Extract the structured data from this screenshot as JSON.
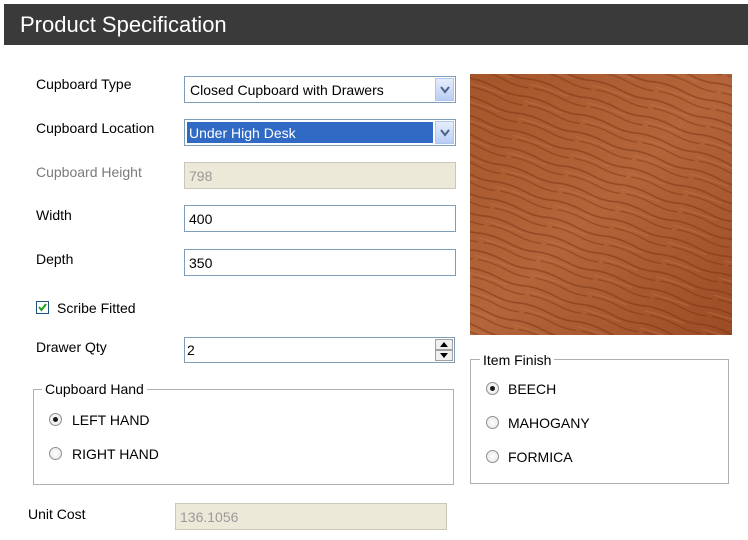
{
  "header": {
    "title": "Product Specification"
  },
  "form": {
    "cupboard_type": {
      "label": "Cupboard Type",
      "value": "Closed Cupboard with Drawers"
    },
    "cupboard_location": {
      "label": "Cupboard Location",
      "value": "Under High Desk"
    },
    "cupboard_height": {
      "label": "Cupboard Height",
      "value": "798"
    },
    "width": {
      "label": "Width",
      "value": "400"
    },
    "depth": {
      "label": "Depth",
      "value": "350"
    },
    "scribe_fitted": {
      "label": "Scribe Fitted",
      "checked": true
    },
    "drawer_qty": {
      "label": "Drawer Qty",
      "value": "2"
    },
    "cupboard_hand": {
      "legend": "Cupboard Hand",
      "options": [
        {
          "label": "LEFT HAND",
          "selected": true
        },
        {
          "label": "RIGHT HAND",
          "selected": false
        }
      ]
    },
    "unit_cost": {
      "label": "Unit Cost",
      "value": "136.1056"
    }
  },
  "finish": {
    "legend": "Item Finish",
    "swatch_color": "#9c4a1f",
    "options": [
      {
        "label": "BEECH",
        "selected": true
      },
      {
        "label": "MAHOGANY",
        "selected": false
      },
      {
        "label": "FORMICA",
        "selected": false
      }
    ]
  }
}
